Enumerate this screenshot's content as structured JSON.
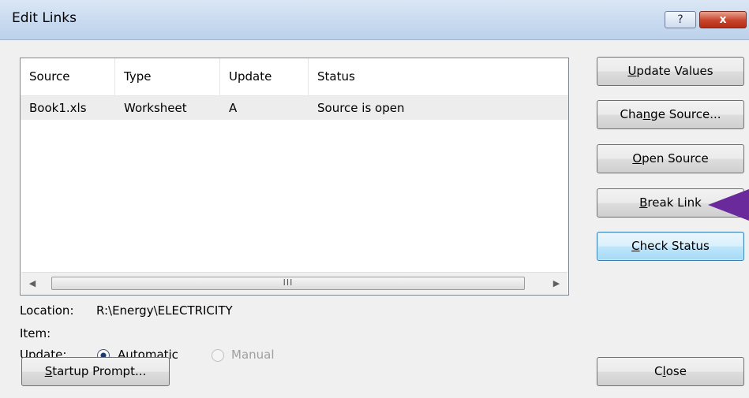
{
  "window": {
    "title": "Edit Links",
    "help_label": "?",
    "close_label": "x"
  },
  "list": {
    "columns": [
      "Source",
      "Type",
      "Update",
      "Status"
    ],
    "rows": [
      {
        "source": "Book1.xls",
        "type": "Worksheet",
        "update": "A",
        "status": "Source is open"
      }
    ],
    "scroll_left": "◀",
    "scroll_right": "▶",
    "thumb_grip": "III"
  },
  "buttons": {
    "update_values": {
      "pre": "",
      "key": "U",
      "post": "pdate Values"
    },
    "change_source": {
      "pre": "Cha",
      "key": "n",
      "post": "ge Source..."
    },
    "open_source": {
      "pre": "",
      "key": "O",
      "post": "pen Source"
    },
    "break_link": {
      "pre": "",
      "key": "B",
      "post": "reak Link"
    },
    "check_status": {
      "pre": "",
      "key": "C",
      "post": "heck Status"
    },
    "startup_prompt": {
      "pre": "",
      "key": "S",
      "post": "tartup Prompt..."
    },
    "close": {
      "pre": "C",
      "key": "l",
      "post": "ose"
    }
  },
  "details": {
    "location_label": "Location:",
    "location_value": "R:\\Energy\\ELECTRICITY",
    "item_label": "Item:",
    "update_label": "Update:",
    "automatic": {
      "pre": "",
      "key": "A",
      "post": "utomatic",
      "selected": true
    },
    "manual": {
      "label": "Manual",
      "enabled": false
    }
  },
  "colors": {
    "pointer": "#6b2a9c",
    "title_bar": "#c7d9ef",
    "selected_row": "#ededed"
  }
}
